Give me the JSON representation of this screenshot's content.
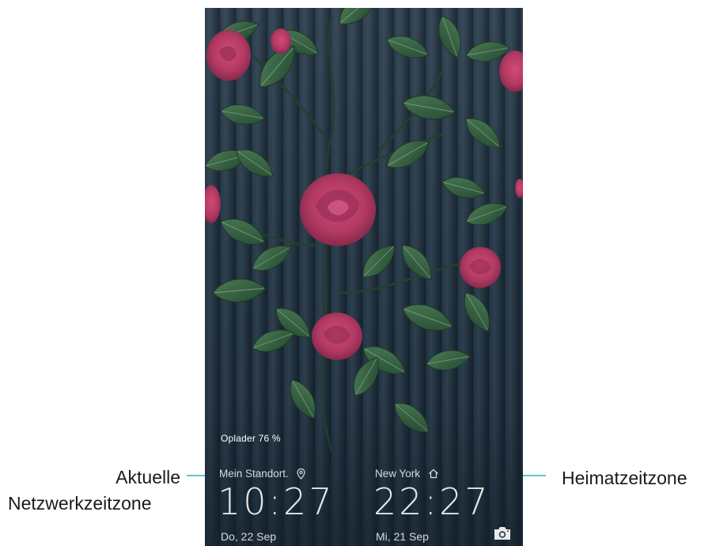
{
  "lock_screen": {
    "charging_status": "Oplader 76 %",
    "clocks": [
      {
        "city": "Mein Standort.",
        "city_icon": "location-pin-icon",
        "time": "10:27",
        "date": "Do, 22 Sep"
      },
      {
        "city": "New York",
        "city_icon": "home-icon",
        "time": "22:27",
        "date": "Mi, 21 Sep"
      }
    ],
    "camera_icon": "camera-icon"
  },
  "callouts": {
    "left_line1": "Aktuelle",
    "left_line2": "Netzwerkzeitzone",
    "right": "Heimatzeitzone"
  },
  "colors": {
    "callout_line": "#5cc7cf",
    "wallpaper": "#243747",
    "leaf": "#2f5a3a",
    "rose": "#b23a62"
  }
}
